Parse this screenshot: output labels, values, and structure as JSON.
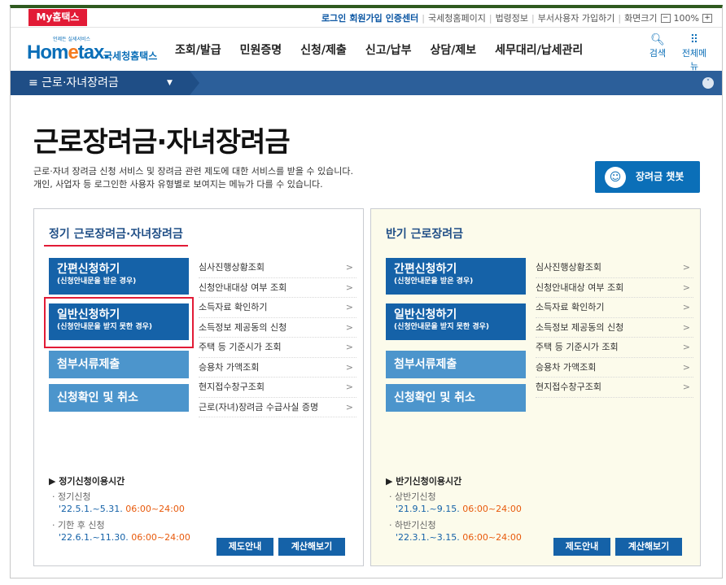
{
  "util": {
    "myhometax": "My홈택스",
    "links": [
      "로그인",
      "회원가입",
      "인증센터",
      "국세청홈페이지",
      "법령정보",
      "부서사용자 가입하기",
      "화면크기"
    ],
    "zoom_minus": "−",
    "zoom": "100%",
    "zoom_plus": "+"
  },
  "header": {
    "logo_small": "언제든 실세서비스",
    "logo_main_a": "Hom",
    "logo_main_e": "e",
    "logo_main_b": "tax.",
    "logo_sub": "국세청홈택스",
    "nav": [
      "조회/발급",
      "민원증명",
      "신청/제출",
      "신고/납부",
      "상담/제보",
      "세무대리/납세관리"
    ],
    "search_label": "검색",
    "menu_label": "전체메뉴"
  },
  "breadcrumb": {
    "label": "≡  근로·자녀장려금"
  },
  "page": {
    "title": "근로장려금·자녀장려금",
    "desc1": "근로·자녀 장려금 신청 서비스 및 장려금 관련 제도에 대한 서비스를 받을 수 있습니다.",
    "desc2": "개인, 사업자 등 로그인한 사용자 유형별로 보여지는 메뉴가 다를 수 있습니다.",
    "chatbot": "장려금 챗봇"
  },
  "regular": {
    "title": "정기 근로장려금·자녀장려금",
    "simple_title": "간편신청하기",
    "simple_sub": "(신청안내문을 받은 경우)",
    "general_title": "일반신청하기",
    "general_sub": "(신청안내문을 받지 못한 경우)",
    "attach": "첨부서류제출",
    "confirm": "신청확인 및 취소",
    "sublinks": [
      "심사진행상황조회",
      "신청안내대상 여부 조회",
      "소득자료 확인하기",
      "소득정보 제공동의 신청",
      "주택 등 기준시가 조회",
      "승용차 가액조회",
      "현지접수창구조회",
      "근로(자녀)장려금 수급사실 증명"
    ],
    "usage_heading": "▶ 정기신청이용시간",
    "usage_1_label": "· 정기신청",
    "usage_1_date": "'22.5.1.~5.31.",
    "usage_1_time": "06:00~24:00",
    "usage_2_label": "· 기한 후 신청",
    "usage_2_date": "'22.6.1.~11.30.",
    "usage_2_time": "06:00~24:00",
    "btn_guide": "제도안내",
    "btn_calc": "계산해보기"
  },
  "half": {
    "title": "반기 근로장려금",
    "simple_title": "간편신청하기",
    "simple_sub": "(신청안내문을 받은 경우)",
    "general_title": "일반신청하기",
    "general_sub": "(신청안내문을 받지 못한 경우)",
    "attach": "첨부서류제출",
    "confirm": "신청확인 및 취소",
    "sublinks": [
      "심사진행상황조회",
      "신청안내대상 여부 조회",
      "소득자료 확인하기",
      "소득정보 제공동의 신청",
      "주택 등 기준시가 조회",
      "승용차 가액조회",
      "현지접수창구조회"
    ],
    "usage_heading": "▶ 반기신청이용시간",
    "usage_1_label": "· 상반기신청",
    "usage_1_date": "'21.9.1.~9.15.",
    "usage_1_time": "06:00~24:00",
    "usage_2_label": "· 하반기신청",
    "usage_2_date": "'22.3.1.~3.15.",
    "usage_2_time": "06:00~24:00",
    "btn_guide": "제도안내",
    "btn_calc": "계산해보기"
  }
}
